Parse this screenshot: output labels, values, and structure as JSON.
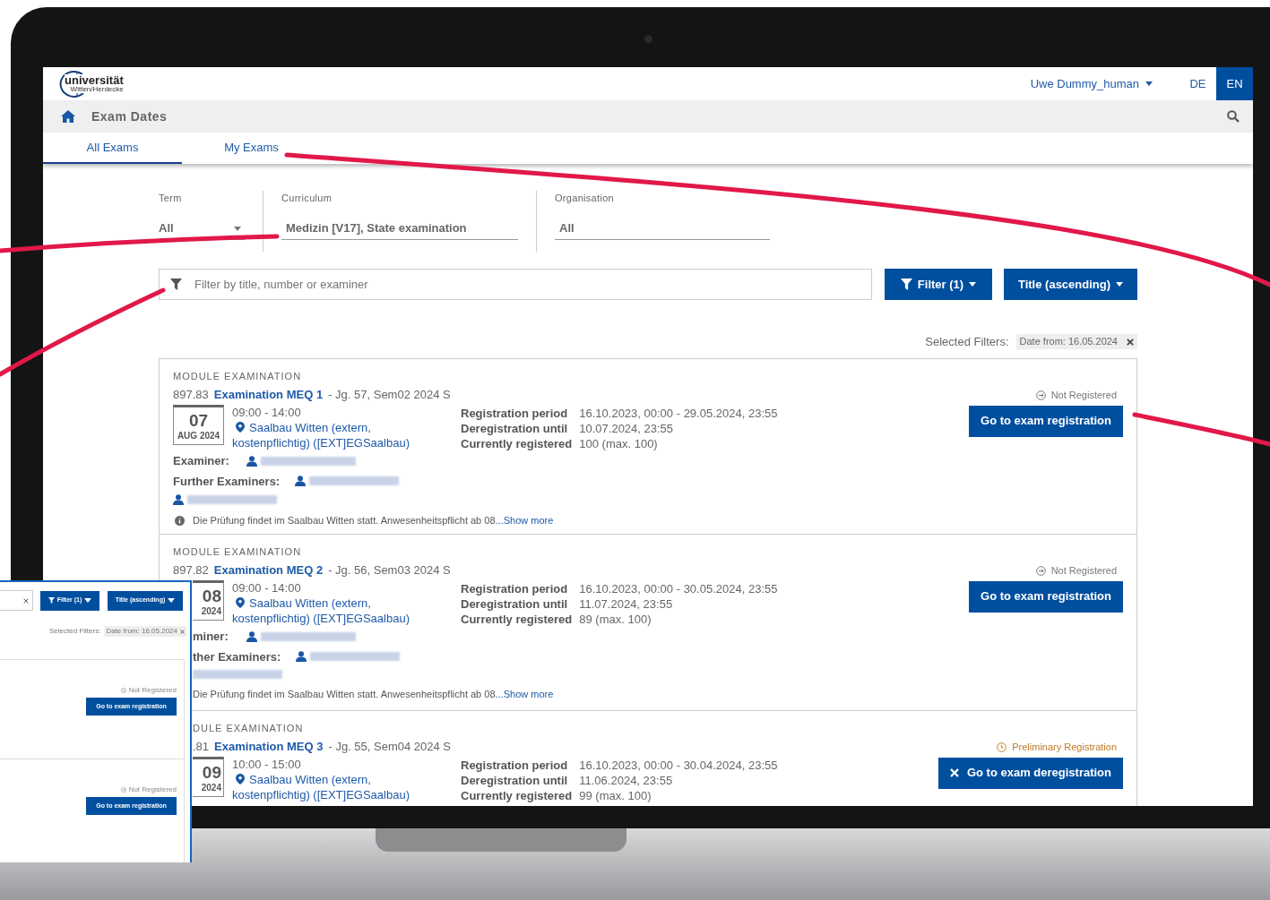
{
  "header": {
    "logo": {
      "wordmark": "universität",
      "subtitle": "Witten/Herdecke"
    },
    "user": "Uwe Dummy_human",
    "languages": [
      {
        "label": "DE",
        "selected": false
      },
      {
        "label": "EN",
        "selected": true
      }
    ]
  },
  "nav": {
    "title": "Exam Dates"
  },
  "tabs": [
    {
      "label": "All Exams",
      "selected": true
    },
    {
      "label": "My Exams",
      "selected": false
    }
  ],
  "filters": [
    {
      "label": "Term",
      "value": "All",
      "kind": "dropdown"
    },
    {
      "label": "Curriculum",
      "value": "Medizin [V17], State examination",
      "kind": "text"
    },
    {
      "label": "Organisation",
      "value": "All",
      "kind": "text"
    }
  ],
  "search": {
    "placeholder": "Filter by title, number or examiner"
  },
  "buttons": [
    {
      "label": "Filter (1)",
      "kind": "filter"
    },
    {
      "label": "Title (ascending)",
      "kind": "sort"
    }
  ],
  "selected_filters": {
    "label": "Selected Filters:",
    "chips": [
      "Date from: 16.05.2024"
    ]
  },
  "exams": [
    {
      "kind": "uncovered",
      "type": "MODULE EXAMINATION",
      "number": "897.83",
      "title": "Examination MEQ 1",
      "meta": "- Jg. 57, Sem02 2024 S",
      "day": "07",
      "month": "AUG 2024",
      "time": "09:00 - 14:00",
      "location": "Saalbau Witten (extern, kostenpflichtig) ([EXT]EGSaalbau)",
      "examiner_label": "Examiner:",
      "examiners": [
        {
          "kind": "with_icon"
        }
      ],
      "further_label": "Further Examiners:",
      "further_examiners": [
        {
          "kind": "with_icon"
        },
        {
          "kind": "with_icon"
        }
      ],
      "registration": [
        {
          "label": "Registration period",
          "value": "16.10.2023, 00:00 - 29.05.2024, 23:55"
        },
        {
          "label": "Deregistration until",
          "value": "10.07.2024, 23:55"
        },
        {
          "label": "Currently registered",
          "value": "100 (max. 100)"
        }
      ],
      "note": "Die Prüfung findet im Saalbau Witten statt. Anwesenheitspflicht ab 08",
      "show_more": "...Show more",
      "status": {
        "kind": "not_registered",
        "label": "Not Registered"
      },
      "action": {
        "kind": "register",
        "label": "Go to exam registration"
      }
    },
    {
      "kind": "body_covered",
      "type": "MODULE EXAMINATION",
      "number": "897.82",
      "title": "Examination MEQ 2",
      "meta": "- Jg. 56, Sem03 2024 S",
      "day": "08",
      "month": "2024",
      "time": "09:00 - 14:00",
      "location": "Saalbau Witten (extern, kostenpflichtig) ([EXT]EGSaalbau)",
      "examiner_label": "miner:",
      "examiners": [
        {
          "kind": "with_icon"
        }
      ],
      "further_label": "ther Examiners:",
      "further_examiners": [
        {
          "kind": "with_icon"
        },
        {
          "kind": "plain"
        }
      ],
      "registration": [
        {
          "label": "Registration period",
          "value": "16.10.2023, 00:00 - 30.05.2024, 23:55"
        },
        {
          "label": "Deregistration until",
          "value": "11.07.2024, 23:55"
        },
        {
          "label": "Currently registered",
          "value": "89 (max. 100)"
        }
      ],
      "note": "Die Prüfung findet im Saalbau Witten statt. Anwesenheitspflicht ab 08",
      "show_more": "...Show more",
      "status": {
        "kind": "not_registered",
        "label": "Not Registered"
      },
      "action": {
        "kind": "register",
        "label": "Go to exam registration"
      }
    },
    {
      "kind": "left_covered",
      "type": "DULE EXAMINATION",
      "number": ".81",
      "title": "Examination MEQ 3",
      "meta": "- Jg. 55, Sem04 2024 S",
      "day": "09",
      "month": "2024",
      "time": "10:00 - 15:00",
      "location": "Saalbau Witten (extern, kostenpflichtig) ([EXT]EGSaalbau)",
      "registration": [
        {
          "label": "Registration period",
          "value": "16.10.2023, 00:00 - 30.04.2024, 23:55"
        },
        {
          "label": "Deregistration until",
          "value": "11.06.2024, 23:55"
        },
        {
          "label": "Currently registered",
          "value": "99 (max. 100)"
        }
      ],
      "status": {
        "kind": "preliminary",
        "label": "Preliminary Registration"
      },
      "action": {
        "kind": "deregister",
        "label": "Go to exam deregistration"
      }
    }
  ],
  "inset": {
    "buttons": [
      "Filter (1)",
      "Title (ascending)"
    ],
    "selected_label": "Selected Filters:",
    "chip": "Date from: 16.05.2024",
    "cards": [
      {
        "status": "Not Registered",
        "action": "Go to exam registration"
      },
      {
        "status": "Not Registered",
        "action": "Go to exam registration"
      }
    ]
  }
}
